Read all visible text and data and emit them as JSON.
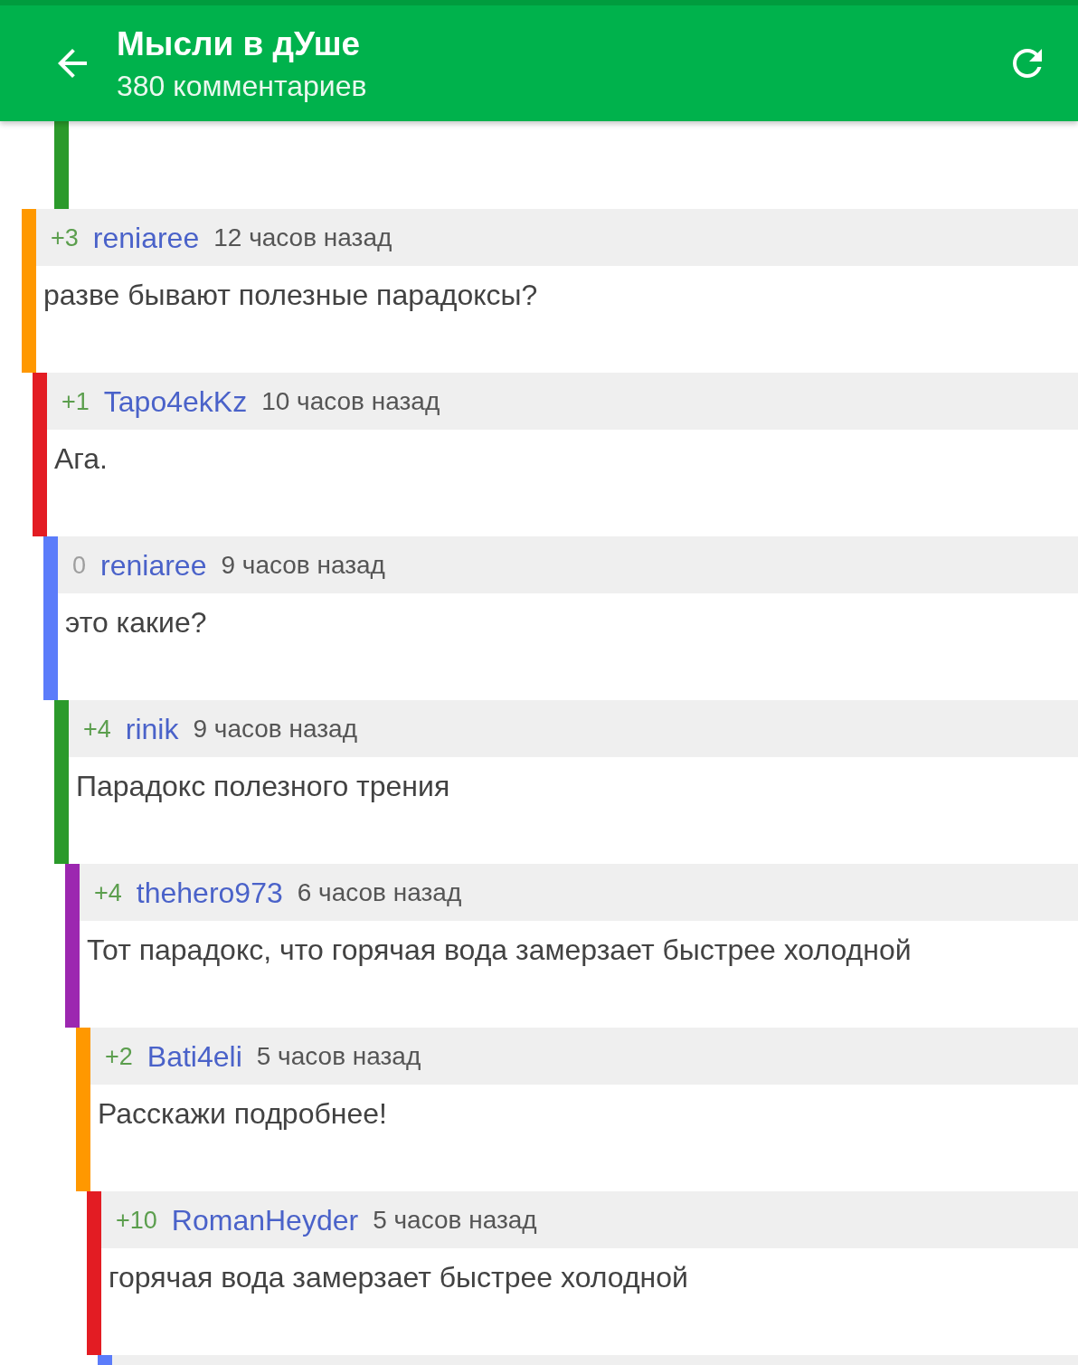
{
  "app_bar": {
    "title": "Мысли в дУше",
    "subtitle": "380 комментариев"
  },
  "thread_tail_above": {
    "color": "#2b9a2b"
  },
  "comments": [
    {
      "score": "+3",
      "positive": true,
      "author": "reniaree",
      "time": "12 часов назад",
      "text": "разве бывают полезные парадоксы?",
      "color": "#ff9800",
      "children": [
        {
          "score": "+1",
          "positive": true,
          "author": "Tapo4ekKz",
          "time": "10 часов назад",
          "text": "Ага.",
          "color": "#e31c23",
          "children": [
            {
              "score": "0",
              "positive": false,
              "author": "reniaree",
              "time": "9 часов назад",
              "text": "это какие?",
              "color": "#5b7cfa",
              "children": [
                {
                  "score": "+4",
                  "positive": true,
                  "author": "rinik",
                  "time": "9 часов назад",
                  "text": "Парадокс полезного трения",
                  "color": "#2b9a2b",
                  "children": [
                    {
                      "score": "+4",
                      "positive": true,
                      "author": "thehero973",
                      "time": "6 часов назад",
                      "text": "Тот парадокс, что горячая вода замерзает быстрее холодной",
                      "color": "#9c27b0",
                      "children": [
                        {
                          "score": "+2",
                          "positive": true,
                          "author": "Bati4eli",
                          "time": "5 часов назад",
                          "text": "Расскажи подробнее!",
                          "color": "#ff9800",
                          "children": [
                            {
                              "score": "+10",
                              "positive": true,
                              "author": "RomanHeyder",
                              "time": "5 часов назад",
                              "text": "горячая вода замерзает быстрее холодной",
                              "color": "#e31c23",
                              "children": [
                                {
                                  "color": "#5b7cfa"
                                }
                              ]
                            }
                          ]
                        }
                      ]
                    }
                  ]
                }
              ]
            }
          ]
        }
      ]
    }
  ]
}
